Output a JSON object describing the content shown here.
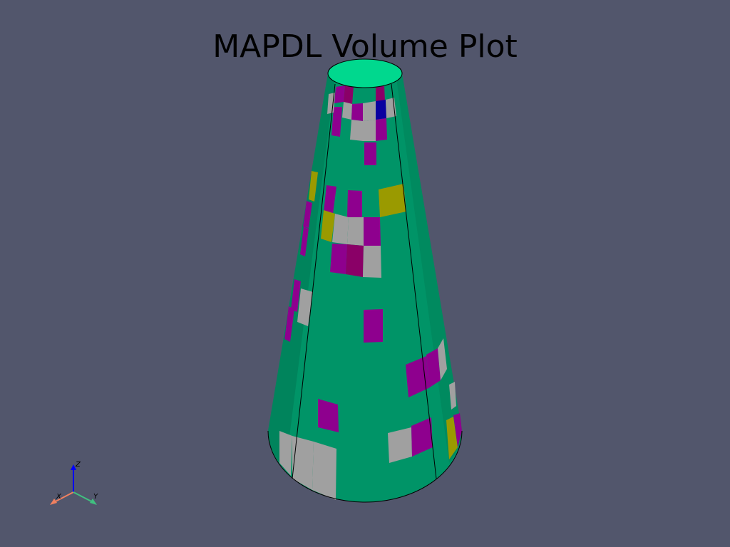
{
  "title": "MAPDL Volume Plot",
  "colors": {
    "background": "#52566c",
    "body": "#009467",
    "body_dark": "#007a55",
    "top_face": "#00d88e",
    "magenta": "#8e008e",
    "crimson": "#8a0067",
    "gray": "#a0a0a0",
    "yellow": "#9a9a00",
    "blue": "#0a00a0"
  },
  "axes_widget": {
    "x_label": "X",
    "y_label": "Y",
    "z_label": "Z",
    "x_color": "#f08060",
    "y_color": "#40c080",
    "z_color": "#0000ff"
  }
}
